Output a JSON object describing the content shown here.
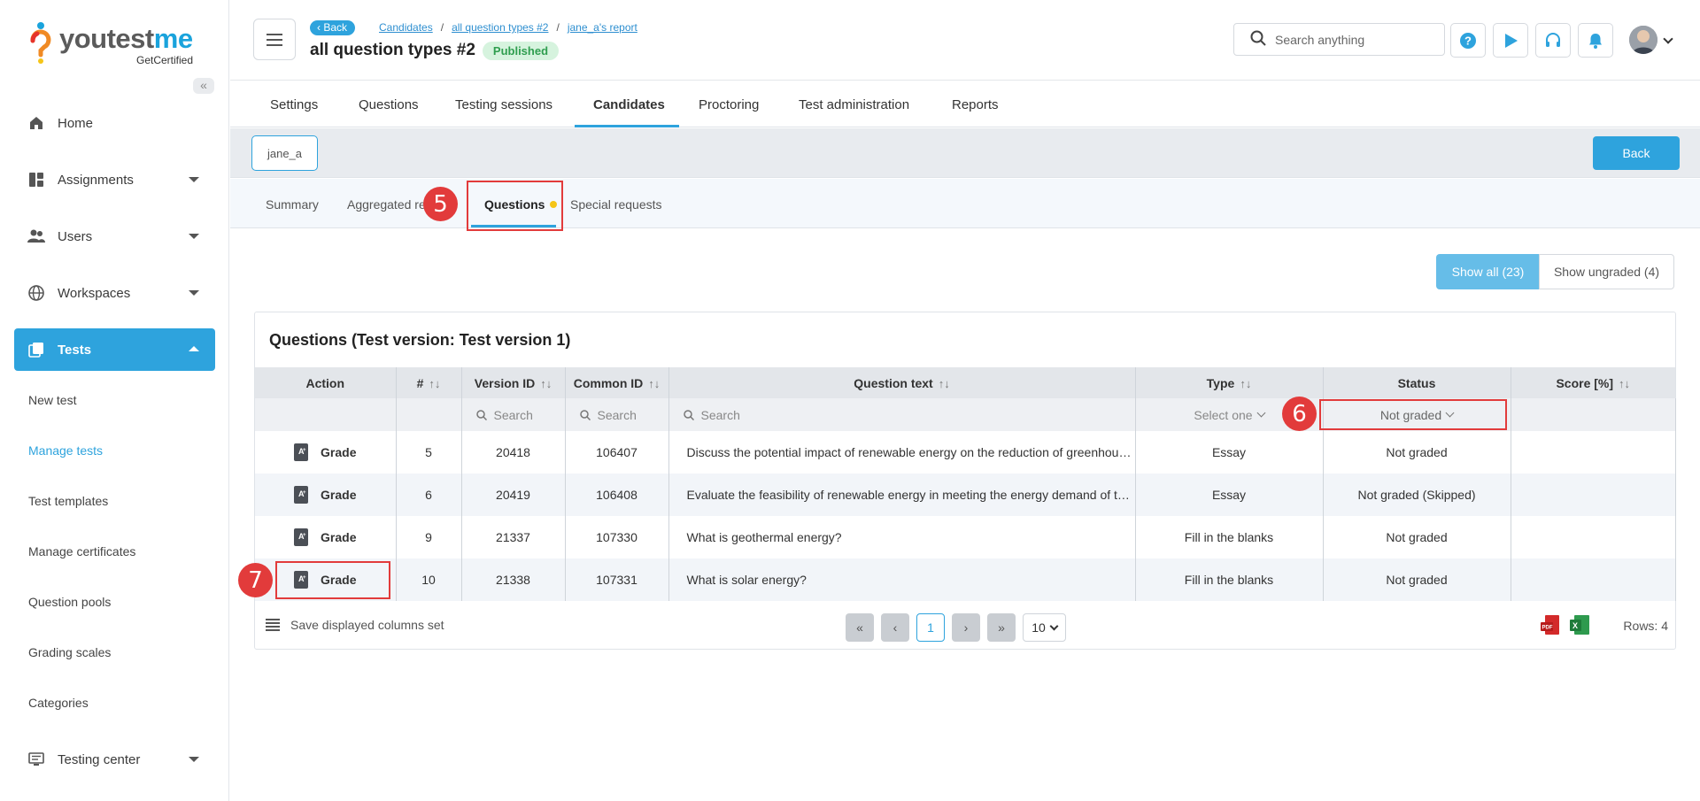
{
  "brand": {
    "logo_text_a": "youtest",
    "logo_text_b": "me",
    "tagline": "GetCertified"
  },
  "sidebar": {
    "items": [
      {
        "label": "Home",
        "icon": "home-icon"
      },
      {
        "label": "Assignments",
        "icon": "assignments-icon"
      },
      {
        "label": "Users",
        "icon": "users-icon"
      },
      {
        "label": "Workspaces",
        "icon": "globe-icon"
      },
      {
        "label": "Tests",
        "icon": "tests-icon"
      },
      {
        "label": "Testing center",
        "icon": "monitor-icon"
      }
    ],
    "sub_items": [
      "New test",
      "Manage tests",
      "Test templates",
      "Manage certificates",
      "Question pools",
      "Grading scales",
      "Categories"
    ]
  },
  "header": {
    "back_label": "Back",
    "breadcrumbs": [
      "Candidates",
      "all question types #2",
      "jane_a's report"
    ],
    "title": "all question types #2",
    "status_badge": "Published",
    "search_placeholder": "Search anything"
  },
  "top_tabs": [
    "Settings",
    "Questions",
    "Testing sessions",
    "Candidates",
    "Proctoring",
    "Test administration",
    "Reports"
  ],
  "candidate": {
    "chip": "jane_a",
    "back_button": "Back"
  },
  "sub_tabs": [
    "Summary",
    "Aggregated re",
    "Questions",
    "Special requests"
  ],
  "annotations": [
    "5",
    "6",
    "7"
  ],
  "filters": {
    "show_all": "Show all (23)",
    "show_ungraded": "Show ungraded (4)"
  },
  "panel": {
    "title": "Questions (Test version: Test version 1)",
    "columns": [
      "Action",
      "#",
      "Version ID",
      "Common ID",
      "Question text",
      "Type",
      "Status",
      "Score [%]"
    ],
    "sort_glyph": "↑↓",
    "filter_search": "Search",
    "type_filter": "Select one",
    "status_filter": "Not graded",
    "rows": [
      {
        "action": "Grade",
        "num": "5",
        "version_id": "20418",
        "common_id": "106407",
        "text": "Discuss the potential impact of renewable energy on the reduction of greenhouse gas emissions",
        "type": "Essay",
        "status": "Not graded",
        "score": ""
      },
      {
        "action": "Grade",
        "num": "6",
        "version_id": "20419",
        "common_id": "106408",
        "text": "Evaluate the feasibility of renewable energy in meeting the energy demand of the future",
        "type": "Essay",
        "status": "Not graded (Skipped)",
        "score": ""
      },
      {
        "action": "Grade",
        "num": "9",
        "version_id": "21337",
        "common_id": "107330",
        "text": "What is geothermal energy?",
        "type": "Fill in the blanks",
        "status": "Not graded",
        "score": ""
      },
      {
        "action": "Grade",
        "num": "10",
        "version_id": "21338",
        "common_id": "107331",
        "text": "What is solar energy?",
        "type": "Fill in the blanks",
        "status": "Not graded",
        "score": ""
      }
    ],
    "footer": {
      "save_columns": "Save displayed columns set",
      "current_page": "1",
      "page_size": "10",
      "rows_label": "Rows: 4"
    }
  }
}
